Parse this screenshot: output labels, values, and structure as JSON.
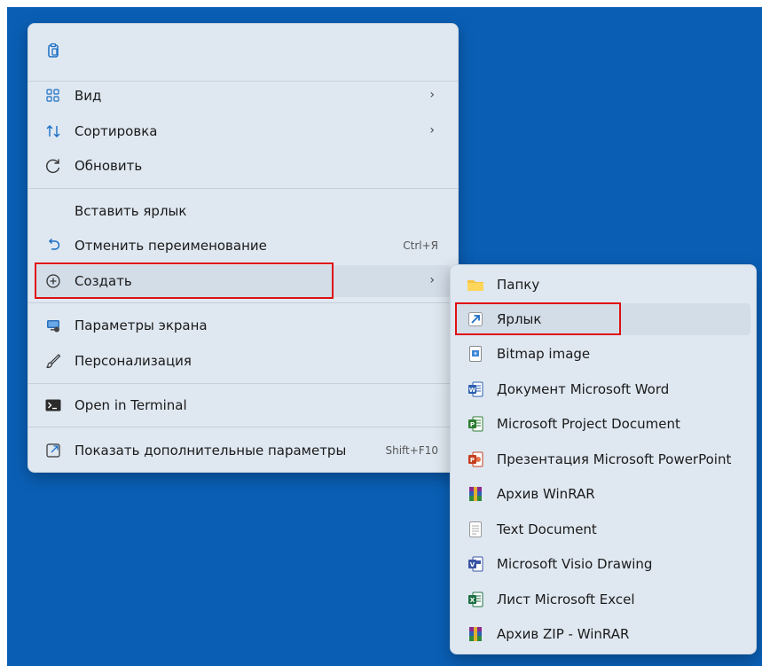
{
  "context_menu": {
    "paste_icon": "clipboard-icon",
    "items": [
      {
        "label": "Вид",
        "icon": "grid-icon",
        "has_submenu": true
      },
      {
        "label": "Сортировка",
        "icon": "sort-arrows-icon",
        "has_submenu": true
      },
      {
        "label": "Обновить",
        "icon": "refresh-icon"
      },
      {
        "label": "Вставить ярлык"
      },
      {
        "label": "Отменить переименование",
        "icon": "undo-icon",
        "shortcut": "Ctrl+Я"
      },
      {
        "label": "Создать",
        "icon": "plus-circle-icon",
        "has_submenu": true,
        "highlighted": true
      },
      {
        "label": "Параметры экрана",
        "icon": "display-settings-icon"
      },
      {
        "label": "Персонализация",
        "icon": "brush-icon"
      },
      {
        "label": "Open in Terminal",
        "icon": "terminal-icon"
      },
      {
        "label": "Показать дополнительные параметры",
        "icon": "open-external-icon",
        "shortcut": "Shift+F10"
      }
    ]
  },
  "create_submenu": {
    "items": [
      {
        "label": "Папку",
        "icon": "folder-icon"
      },
      {
        "label": "Ярлык",
        "icon": "shortcut-icon",
        "highlighted": true
      },
      {
        "label": "Bitmap image",
        "icon": "bitmap-icon"
      },
      {
        "label": "Документ Microsoft Word",
        "icon": "word-icon"
      },
      {
        "label": "Microsoft Project Document",
        "icon": "project-icon"
      },
      {
        "label": "Презентация Microsoft PowerPoint",
        "icon": "powerpoint-icon"
      },
      {
        "label": "Архив WinRAR",
        "icon": "winrar-icon"
      },
      {
        "label": "Text Document",
        "icon": "text-document-icon"
      },
      {
        "label": "Microsoft Visio Drawing",
        "icon": "visio-icon"
      },
      {
        "label": "Лист Microsoft Excel",
        "icon": "excel-icon"
      },
      {
        "label": "Архив ZIP - WinRAR",
        "icon": "winrar-zip-icon"
      }
    ]
  },
  "colors": {
    "desktop": "#0a5fb5",
    "menu_background": "#dfe8f1",
    "highlight": "#d3dde8",
    "annotation_red": "#e01010"
  }
}
